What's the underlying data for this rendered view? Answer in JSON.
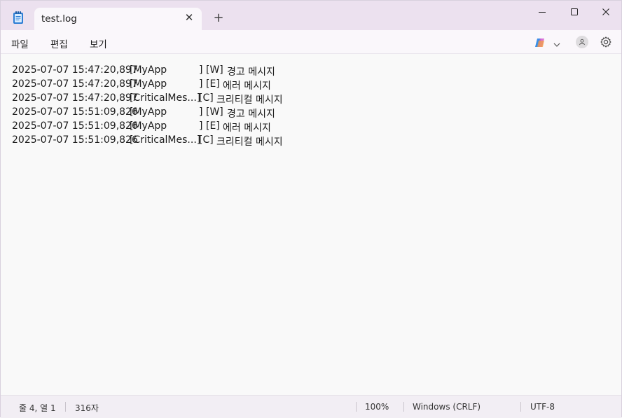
{
  "tab": {
    "title": "test.log"
  },
  "menu": {
    "file": "파일",
    "edit": "편집",
    "view": "보기"
  },
  "lines": [
    {
      "ts": "2025-07-07 15:47:20,897",
      "src": "[MyApp",
      "srcEnd": "]",
      "lvl": "[W]",
      "msg": "경고 메시지"
    },
    {
      "ts": "2025-07-07 15:47:20,897",
      "src": "[MyApp",
      "srcEnd": "]",
      "lvl": "[E]",
      "msg": "에러 메시지"
    },
    {
      "ts": "2025-07-07 15:47:20,897",
      "src": "[CriticalMes...]",
      "srcEnd": "",
      "lvl": "[C]",
      "msg": "크리티컬 메시지"
    },
    {
      "ts": "2025-07-07 15:51:09,826",
      "src": "[MyApp",
      "srcEnd": "]",
      "lvl": "[W]",
      "msg": "경고 메시지"
    },
    {
      "ts": "2025-07-07 15:51:09,826",
      "src": "[MyApp",
      "srcEnd": "]",
      "lvl": "[E]",
      "msg": "에러 메시지"
    },
    {
      "ts": "2025-07-07 15:51:09,826",
      "src": "[CriticalMes...]",
      "srcEnd": "",
      "lvl": "[C]",
      "msg": "크리티컬 메시지"
    }
  ],
  "status": {
    "position": "줄 4, 열 1",
    "chars": "316자",
    "zoom": "100%",
    "line_ending": "Windows (CRLF)",
    "encoding": "UTF-8"
  },
  "icons": {
    "app": "notepad-icon",
    "tab_close": "close-icon",
    "new_tab": "plus-icon",
    "minimize": "minimize-icon",
    "maximize": "maximize-icon",
    "close": "close-icon",
    "copilot": "copilot-icon",
    "account": "account-icon",
    "settings": "gear-icon"
  },
  "colors": {
    "titlebar": "#ece1ef",
    "accent": "#1b1b1b"
  }
}
